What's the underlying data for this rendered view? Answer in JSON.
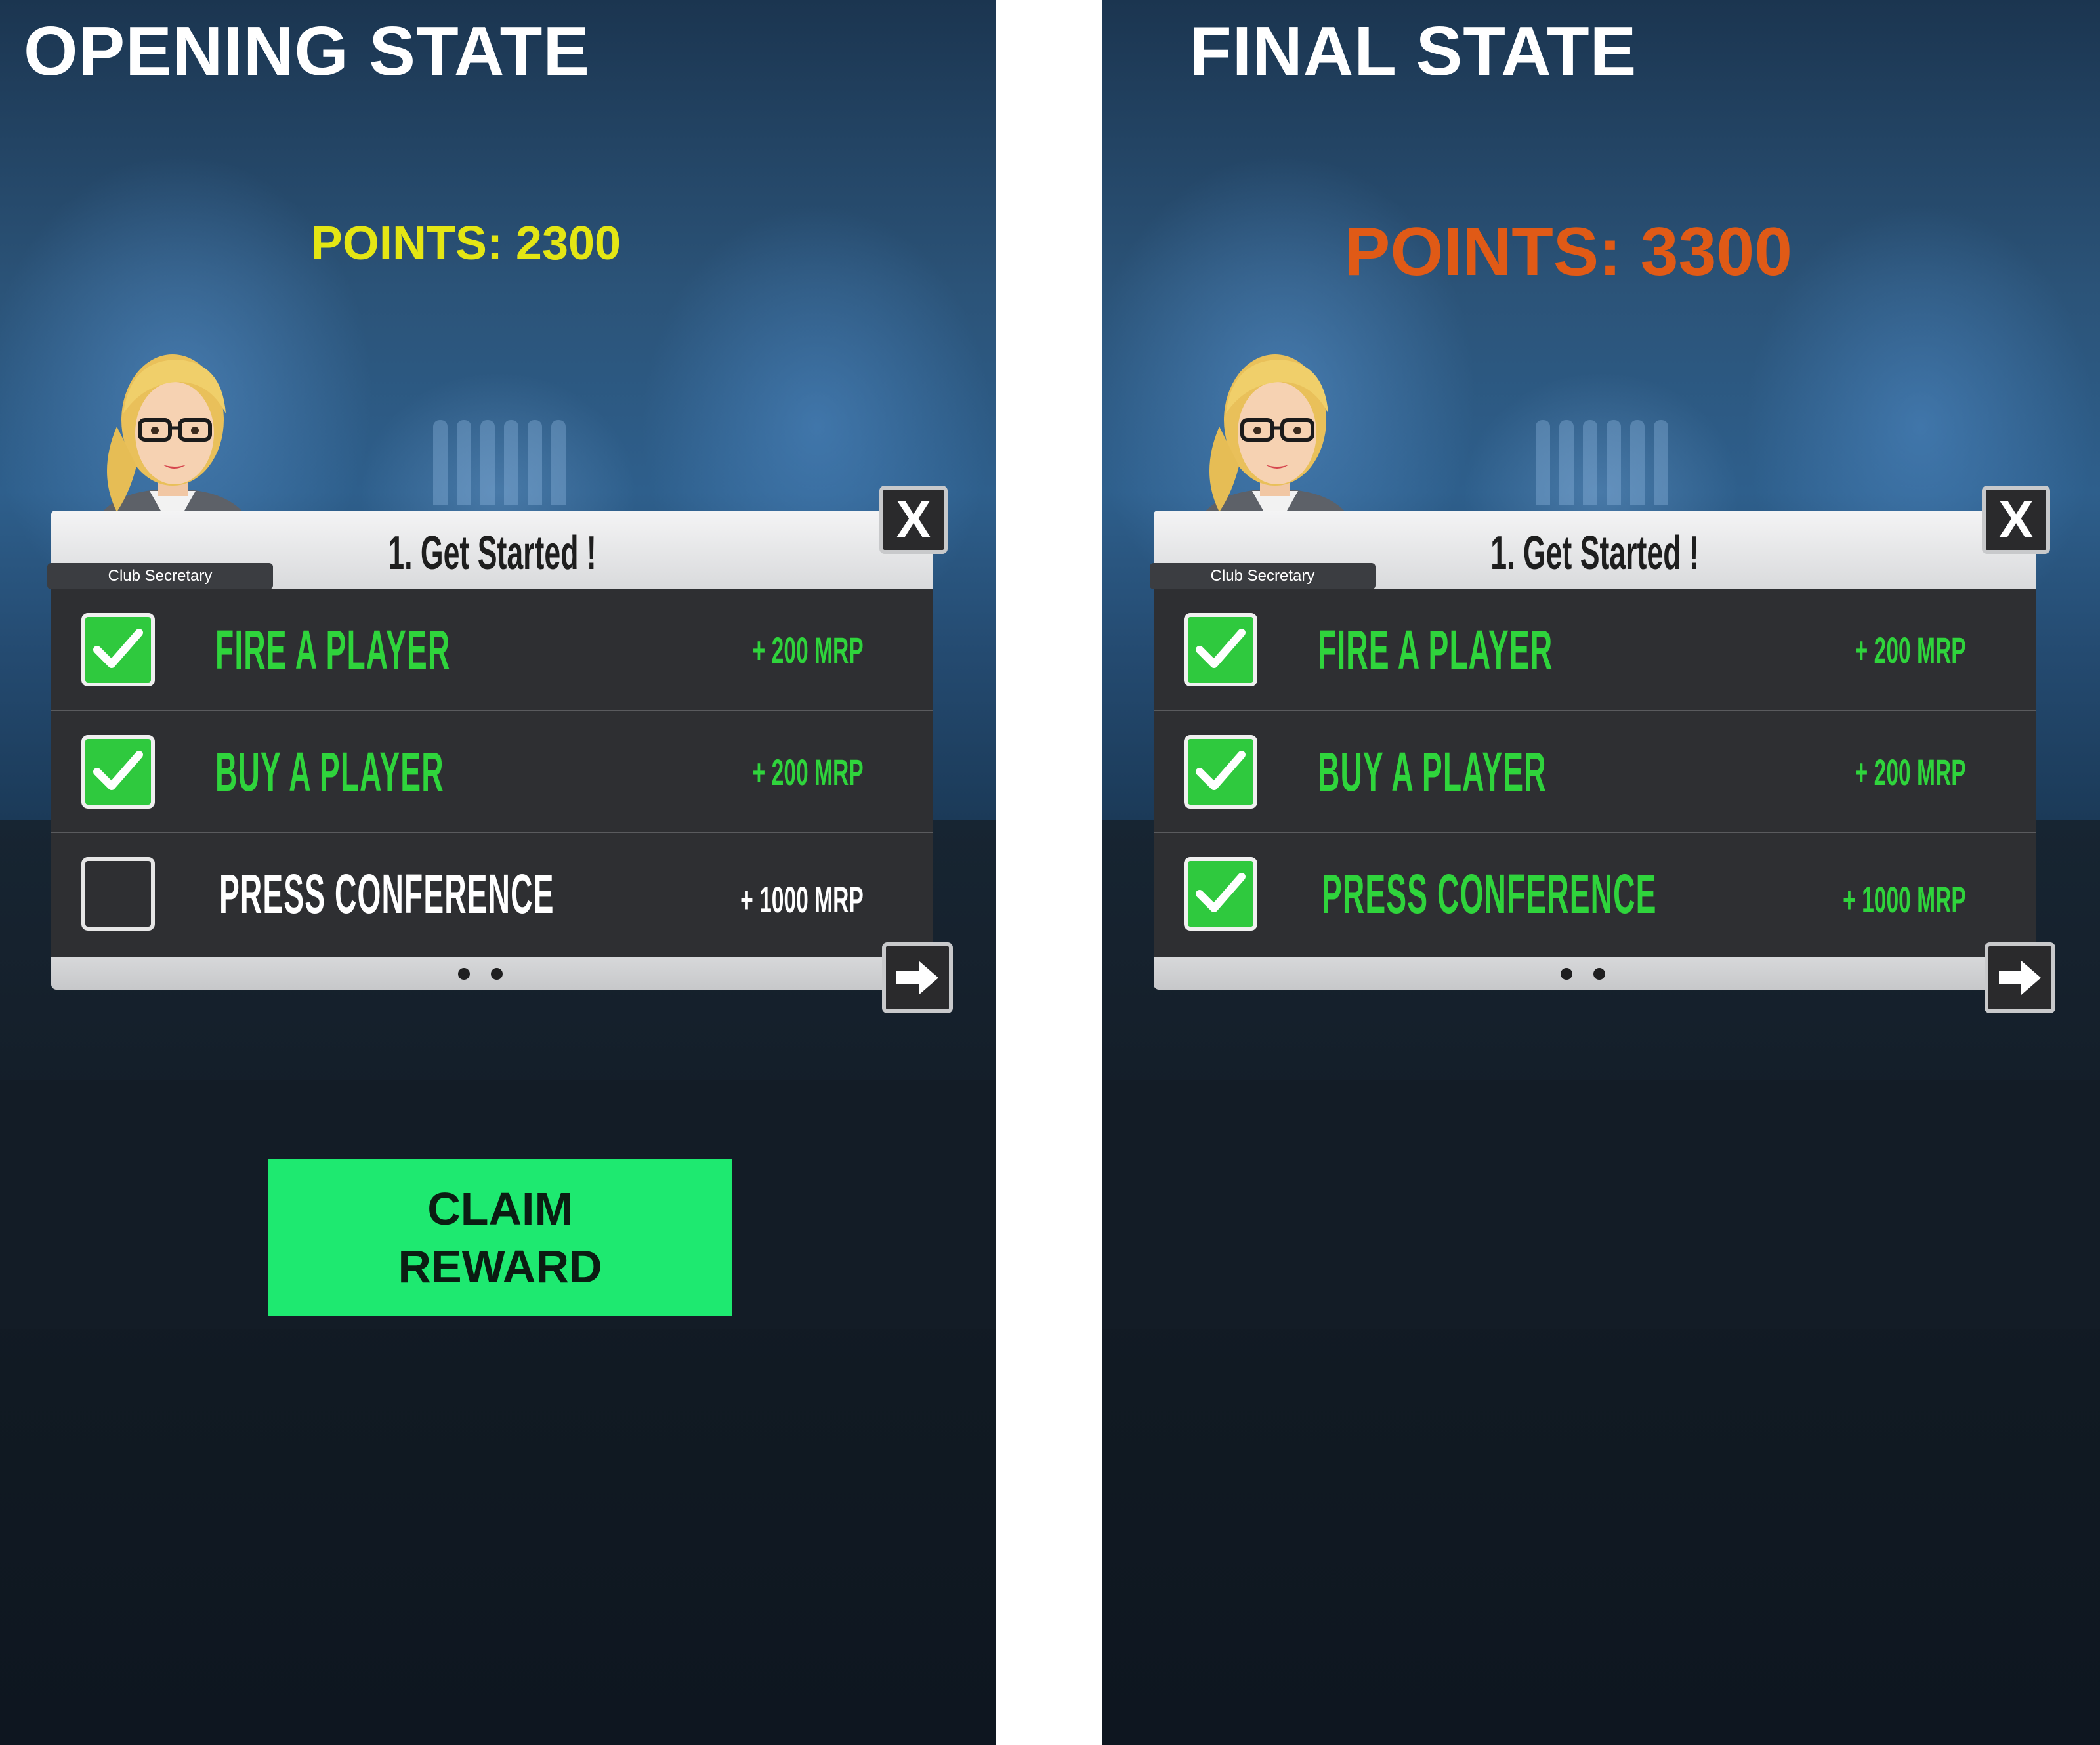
{
  "opening": {
    "state_title": "OPENING STATE",
    "points_label": "POINTS: 2300",
    "points_color": "#e4e614",
    "panel": {
      "title": "1. Get Started !",
      "caption": "Club Secretary",
      "close_label": "X",
      "next_icon": "arrow-right-icon",
      "tasks": [
        {
          "label": "FIRE A PLAYER",
          "reward": "+ 200 MRP",
          "checked": true
        },
        {
          "label": "BUY A PLAYER",
          "reward": "+ 200 MRP",
          "checked": true
        },
        {
          "label": "PRESS CONFERENCE",
          "reward": "+ 1000 MRP",
          "checked": false
        }
      ],
      "pages": 2
    },
    "claim_button": {
      "line1": "CLAIM",
      "line2": "REWARD",
      "color": "#1ee970"
    }
  },
  "final": {
    "state_title": "FINAL STATE",
    "points_label": "POINTS: 3300",
    "points_color": "#e05a16",
    "panel": {
      "title": "1. Get Started !",
      "caption": "Club Secretary",
      "close_label": "X",
      "next_icon": "arrow-right-icon",
      "tasks": [
        {
          "label": "FIRE A PLAYER",
          "reward": "+ 200 MRP",
          "checked": true
        },
        {
          "label": "BUY A PLAYER",
          "reward": "+ 200 MRP",
          "checked": true
        },
        {
          "label": "PRESS CONFERENCE",
          "reward": "+ 1000 MRP",
          "checked": true
        }
      ],
      "pages": 2
    }
  },
  "colors": {
    "task_done": "#2fd43c",
    "task_pending": "#ffffff",
    "check_fill": "#2fc93e"
  }
}
